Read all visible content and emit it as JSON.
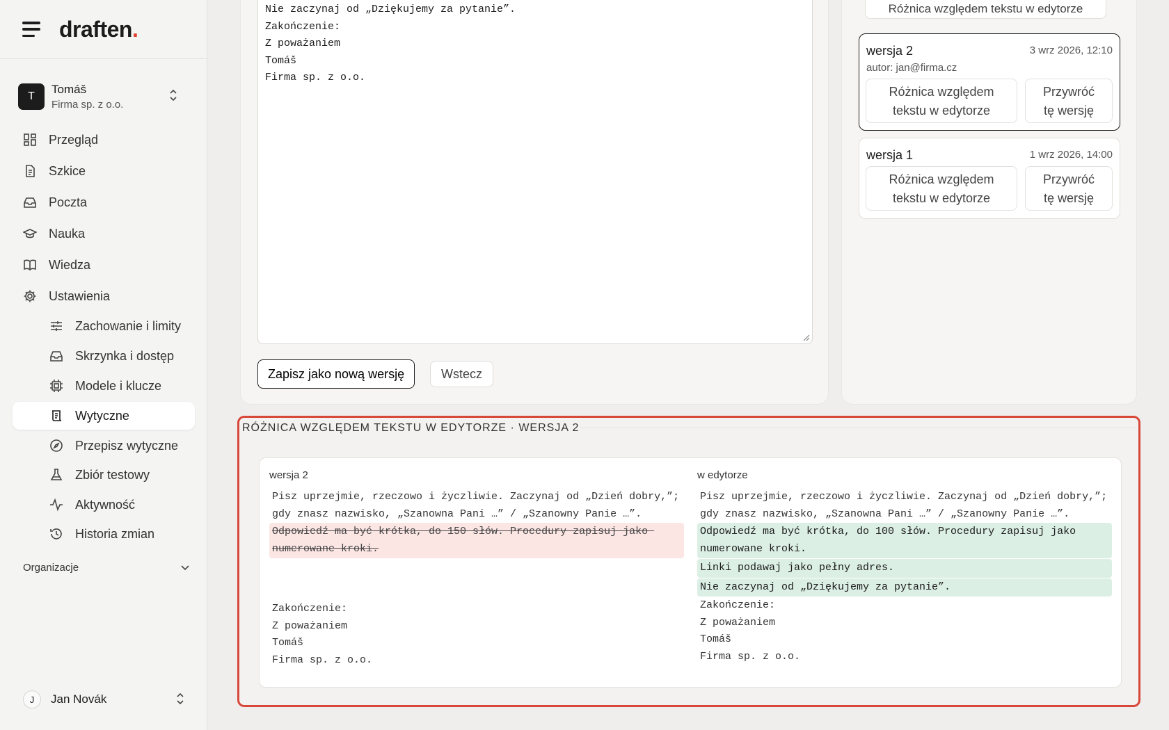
{
  "sidebar": {
    "brand": "draften",
    "brand_dot": ".",
    "account": {
      "initial": "T",
      "name": "Tomáš",
      "org": "Firma sp. z o.o."
    },
    "nav": [
      {
        "label": "Przegląd",
        "icon": "dashboard-icon"
      },
      {
        "label": "Szkice",
        "icon": "document-icon"
      },
      {
        "label": "Poczta",
        "icon": "inbox-icon"
      },
      {
        "label": "Nauka",
        "icon": "graduation-cap-icon"
      },
      {
        "label": "Wiedza",
        "icon": "book-icon"
      },
      {
        "label": "Ustawienia",
        "icon": "gear-icon"
      }
    ],
    "subnav": [
      {
        "label": "Zachowanie i limity",
        "icon": "sliders-icon"
      },
      {
        "label": "Skrzynka i dostęp",
        "icon": "inbox-icon"
      },
      {
        "label": "Modele i klucze",
        "icon": "chip-icon"
      },
      {
        "label": "Wytyczne",
        "icon": "scroll-icon",
        "active": true
      },
      {
        "label": "Przepisz wytyczne",
        "icon": "compass-icon"
      },
      {
        "label": "Zbiór testowy",
        "icon": "flask-icon"
      },
      {
        "label": "Aktywność",
        "icon": "activity-icon"
      },
      {
        "label": "Historia zmian",
        "icon": "history-icon"
      }
    ],
    "organizations_label": "Organizacje",
    "user": {
      "initial": "J",
      "name": "Jan Novák"
    }
  },
  "editor": {
    "lines": [
      "Nie zaczynaj od „Dziękujemy za pytanie”.",
      "Zakończenie:",
      "Z poważaniem",
      "Tomáš",
      "Firma sp. z o.o."
    ],
    "save_label": "Zapisz jako nową wersję",
    "back_label": "Wstecz"
  },
  "versions": {
    "top_button_label": "Różnica względem tekstu w edytorze",
    "items": [
      {
        "title": "wersja 2",
        "date": "3 wrz 2026, 12:10",
        "author": "autor: jan@firma.cz",
        "diff_label_1": "Różnica względem",
        "diff_label_2": "tekstu w edytorze",
        "restore_label_1": "Przywróć",
        "restore_label_2": "tę wersję"
      },
      {
        "title": "wersja 1",
        "date": "1 wrz 2026, 14:00",
        "diff_label_1": "Różnica względem",
        "diff_label_2": "tekstu w edytorze",
        "restore_label_1": "Przywróć",
        "restore_label_2": "tę wersję"
      }
    ]
  },
  "diff": {
    "header": "RÓŻNICA WZGLĘDEM TEKSTU W EDYTORZE · WERSJA 2",
    "left_label": "wersja 2",
    "right_label": "w edytorze",
    "common_intro": "Pisz uprzejmie, rzeczowo i życzliwie. Zaczynaj od „Dzień dobry,”; gdy znasz nazwisko, „Szanowna Pani …” / „Szanowny Panie …”.",
    "removed": "Odpowiedź ma być krótka, do 150 słów. Procedury zapisuj jako numerowane kroki.",
    "added": [
      "Odpowiedź ma być krótka, do 100 słów. Procedury zapisuj jako numerowane kroki.",
      "Linki podawaj jako pełny adres.",
      "Nie zaczynaj od „Dziękujemy za pytanie”."
    ],
    "common_outro": [
      "Zakończenie:",
      "Z poważaniem",
      "Tomáš",
      "Firma sp. z o.o."
    ]
  },
  "colors": {
    "accent_dot": "#e0402e",
    "highlight_frame": "#d8483a",
    "deleted_bg": "#fbe6e4",
    "added_bg": "#dcefe5"
  }
}
